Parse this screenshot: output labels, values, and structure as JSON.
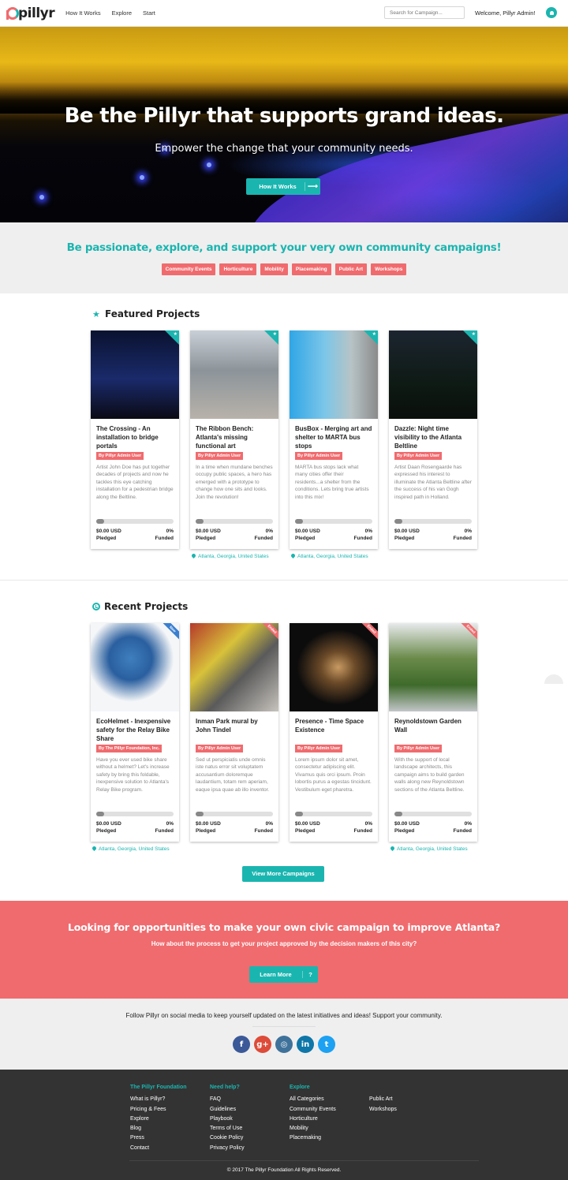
{
  "header": {
    "logo": "pillyr",
    "nav": [
      "How It Works",
      "Explore",
      "Start"
    ],
    "search_placeholder": "Search for Campaign...",
    "welcome": "Welcome, Pillyr Admin!"
  },
  "hero": {
    "title": "Be the Pillyr that supports grand ideas.",
    "subtitle": "Empower the change that your community needs.",
    "button": "How It Works",
    "button_icon": "arrow-right-icon"
  },
  "categories": {
    "heading": "Be passionate, explore, and support your very own community campaigns!",
    "tags": [
      "Community Events",
      "Horticulture",
      "Mobility",
      "Placemaking",
      "Public Art",
      "Workshops"
    ]
  },
  "featured": {
    "title": "Featured Projects",
    "icon": "star-icon",
    "projects": [
      {
        "title": "The Crossing - An installation to bridge portals",
        "author": "By Pillyr Admin User",
        "desc": "Artist John Doe has put together decades of projects and now he tackles this eye catching installation for a pedestrian bridge along the Beltline.",
        "amount": "$0.00 USD",
        "amount_label": "Pledged",
        "pct": "0%",
        "pct_label": "Funded",
        "progress": 0.1,
        "location": ""
      },
      {
        "title": "The Ribbon Bench: Atlanta's missing functional art",
        "author": "By Pillyr Admin User",
        "desc": "In a time when mundane benches occupy public spaces, a hero has emerged with a prototype to change how one sits and looks. Join the revolution!",
        "amount": "$0.00 USD",
        "amount_label": "Pledged",
        "pct": "0%",
        "pct_label": "Funded",
        "progress": 0.1,
        "location": "Atlanta, Georgia, United States"
      },
      {
        "title": "BusBox - Merging art and shelter to MARTA bus stops",
        "author": "By Pillyr Admin User",
        "desc": "MARTA bus stops lack what many cities offer their residents...a shelter from the conditions. Lets bring true artists into this mix!",
        "amount": "$0.00 USD",
        "amount_label": "Pledged",
        "pct": "0%",
        "pct_label": "Funded",
        "progress": 0.1,
        "location": "Atlanta, Georgia, United States"
      },
      {
        "title": "Dazzle: Night time visibility to the Atlanta Beltline",
        "author": "By Pillyr Admin User",
        "desc": "Artist Daan Rosengaarde has expressed his interest to illuminate the Atlanta Beltline after the success of his van Gogh inspired path in Holland.",
        "amount": "$0.00 USD",
        "amount_label": "Pledged",
        "pct": "0%",
        "pct_label": "Funded",
        "progress": 0.1,
        "location": ""
      }
    ]
  },
  "recent": {
    "title": "Recent Projects",
    "icon": "clock-icon",
    "projects": [
      {
        "title": "EcoHelmet - Inexpensive safety for the Relay Bike Share",
        "author": "By The Pillyr Foundation, Inc.",
        "badge": "New",
        "desc": "Have you ever used bike share without a helmet? Let's increase safety by bring this foldable, inexpensive solution to Atlanta's Relay Bike program.",
        "amount": "$0.00 USD",
        "amount_label": "Pledged",
        "pct": "0%",
        "pct_label": "Funded",
        "progress": 0.1,
        "location": "Atlanta, Georgia, United States"
      },
      {
        "title": "Inman Park mural by John Tindel",
        "author": "By Pillyr Admin User",
        "badge": "Ended",
        "desc": "Sed ut perspiciatis unde omnis iste natus error sit voluptatem accusantium doloremque laudantium, totam rem aperiam, eaque ipsa quae ab illo inventor.",
        "amount": "$0.00 USD",
        "amount_label": "Pledged",
        "pct": "0%",
        "pct_label": "Funded",
        "progress": 0.1,
        "location": ""
      },
      {
        "title": "Presence - Time Space Existence",
        "author": "By Pillyr Admin User",
        "badge": "Ended",
        "desc": "Lorem ipsum dolor sit amet, consectetur adipiscing elit. Vivamus quis orci ipsum. Proin lobortis purus a egestas tincidunt. Vestibulum eget pharetra.",
        "amount": "$0.00 USD",
        "amount_label": "Pledged",
        "pct": "0%",
        "pct_label": "Funded",
        "progress": 0.1,
        "location": ""
      },
      {
        "title": "Reynoldstown Garden Wall",
        "author": "By Pillyr Admin User",
        "badge": "Ended",
        "desc": "With the support of local landscape architects, this campaign aims to build garden walls along new Reynoldstown sections of the Atlanta Beltline.",
        "amount": "$0.00 USD",
        "amount_label": "Pledged",
        "pct": "0%",
        "pct_label": "Funded",
        "progress": 0.1,
        "location": "Atlanta, Georgia, United States"
      }
    ],
    "view_more": "View More Campaigns"
  },
  "cta": {
    "heading": "Looking for opportunities to make your own civic campaign to improve Atlanta?",
    "text": "How about the process to get your project approved by the decision makers of this city?",
    "button": "Learn More",
    "button_icon": "?"
  },
  "social": {
    "text": "Follow Pillyr on social media to keep yourself updated on the latest initiatives and ideas! Support your community.",
    "icons": [
      {
        "name": "facebook-icon",
        "glyph": "f",
        "color": "#3b5998"
      },
      {
        "name": "google-plus-icon",
        "glyph": "g+",
        "color": "#dd4b39"
      },
      {
        "name": "instagram-icon",
        "glyph": "◎",
        "color": "#3f729b"
      },
      {
        "name": "linkedin-icon",
        "glyph": "in",
        "color": "#0e76a8"
      },
      {
        "name": "twitter-icon",
        "glyph": "t",
        "color": "#1da1f2"
      }
    ]
  },
  "footer": {
    "columns": [
      {
        "heading": "The Pillyr Foundation",
        "links": [
          "What is Pillyr?",
          "Pricing & Fees",
          "Explore",
          "Blog",
          "Press",
          "Contact"
        ]
      },
      {
        "heading": "Need help?",
        "links": [
          "FAQ",
          "Guidelines",
          "Playbook",
          "Terms of Use",
          "Cookie Policy",
          "Privacy Policy"
        ]
      },
      {
        "heading": "Explore",
        "links": [
          "All Categories",
          "Community Events",
          "Horticulture",
          "Mobility",
          "Placemaking"
        ]
      },
      {
        "heading": "",
        "links": [
          "Public Art",
          "Workshops"
        ]
      }
    ],
    "copyright": "© 2017 The Pillyr Foundation All Rights Reserved."
  },
  "colors": {
    "teal": "#1bb5b0",
    "coral": "#f06b6e",
    "footer": "#333333"
  }
}
